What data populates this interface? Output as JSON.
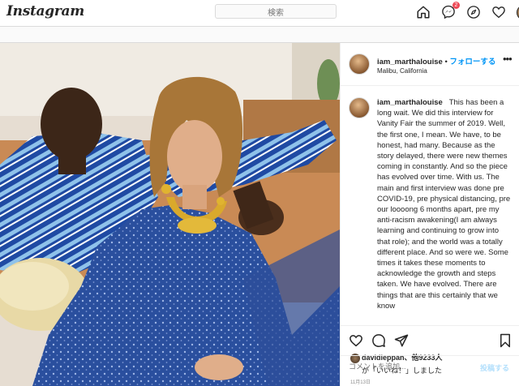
{
  "topbar": {
    "logo": "Instagram",
    "search_placeholder": "検索",
    "notification_count": "2"
  },
  "post": {
    "username": "iam_marthalouise",
    "dot": "•",
    "follow_label": "フォローする",
    "location": "Malibu, California",
    "more": "•••",
    "caption_user": "iam_marthalouise",
    "caption_text": "This has been a long wait. We did this interview for Vanity Fair the summer of 2019. Well, the first one, I mean. We have, to be honest, had many. Because as the story delayed, there were new themes coming in constantly. And so the piece has evolved over time. With us. The main and first interview was done pre COVID-19, pre physical distancing, pre our loooong 6 months apart, pre my anti-racism awakening(I am always learning and continuing to grow into that role); and the world was a totally different place. And so were we. Some times it takes these moments to acknowledge the growth and steps taken. We have evolved. There are things that are this certainly that we know",
    "liked_by_user": "davidleppan",
    "liked_by_others": "、他9233人",
    "liked_suffix": "が「いいね！」しました",
    "date": "11月13日",
    "comment_placeholder": "コメントを追加...",
    "post_label": "投稿する"
  },
  "icons": {
    "home": "home-icon",
    "messenger": "messenger-icon",
    "explore": "compass-icon",
    "activity": "heart-icon",
    "like": "heart-icon",
    "comment": "comment-icon",
    "share": "paper-plane-icon",
    "save": "bookmark-icon"
  },
  "colors": {
    "follow_blue": "#0095f6",
    "badge_red": "#ed4956",
    "text": "#262626",
    "muted": "#8e8e8e"
  }
}
